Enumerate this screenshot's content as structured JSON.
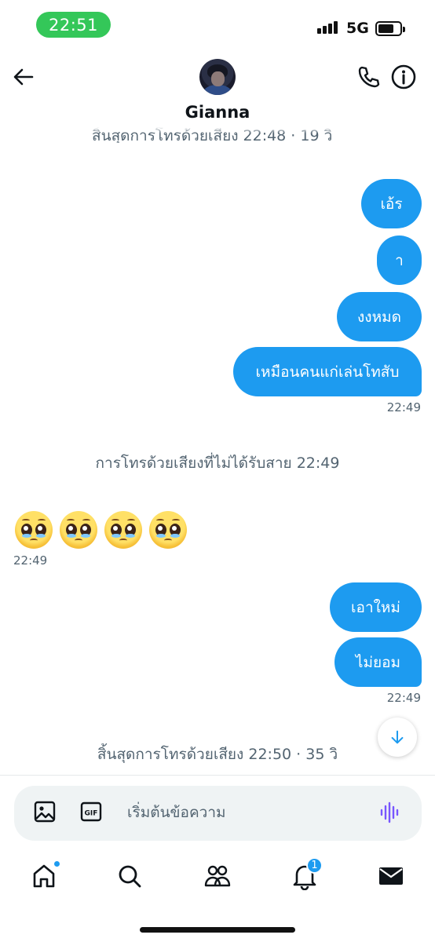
{
  "status_bar": {
    "time": "22:51",
    "network": "5G"
  },
  "header": {
    "contact_name": "Gianna",
    "partial_note": "สิ้นสุดการโทรด้วยเสียง 22:48 · 19 วิ"
  },
  "messages": {
    "sent_group_1": [
      "เอ้ร",
      "า",
      "งงหมด",
      "เหมือนคนแก่เล่นโทสับ"
    ],
    "sent_group_1_time": "22:49",
    "missed_call": "การโทรด้วยเสียงที่ไม่ได้รับสาย 22:49",
    "received_emoji_time": "22:49",
    "sent_group_2": [
      "เอาใหม่",
      "ไม่ยอม"
    ],
    "sent_group_2_time": "22:49",
    "call_ended": "สิ้นสุดการโทรด้วยเสียง 22:50 · 35 วิ"
  },
  "composer": {
    "placeholder": "เริ่มต้นข้อความ",
    "gif_label": "GIF"
  },
  "tabs": {
    "notifications_badge": "1"
  },
  "colors": {
    "accent": "#1d9bf0",
    "status_time_bg": "#34c759",
    "secondary_text": "#536471"
  }
}
